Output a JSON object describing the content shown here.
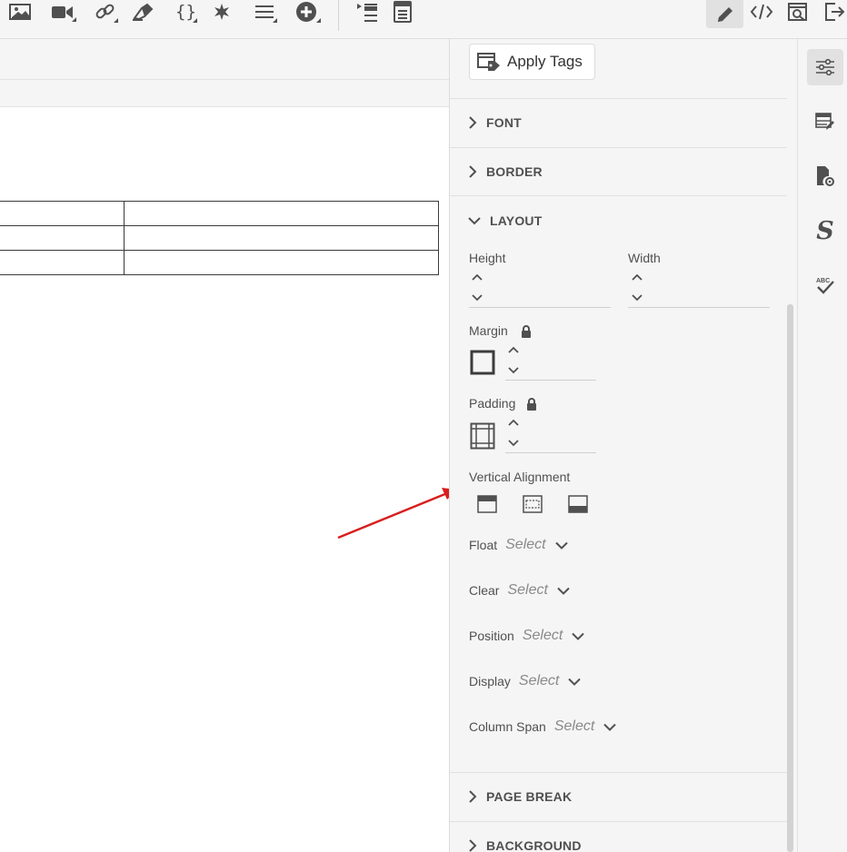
{
  "panel": {
    "apply_tags_label": "Apply Tags",
    "sections": {
      "font": "FONT",
      "border": "BORDER",
      "layout": "LAYOUT",
      "page_break": "PAGE BREAK",
      "background": "BACKGROUND"
    },
    "layout": {
      "height_label": "Height",
      "width_label": "Width",
      "margin_label": "Margin",
      "padding_label": "Padding",
      "vertical_alignment_label": "Vertical Alignment",
      "float": {
        "label": "Float",
        "value": "Select"
      },
      "clear": {
        "label": "Clear",
        "value": "Select"
      },
      "position": {
        "label": "Position",
        "value": "Select"
      },
      "display": {
        "label": "Display",
        "value": "Select"
      },
      "column_span": {
        "label": "Column Span",
        "value": "Select"
      }
    }
  },
  "icons": {
    "toolbar": [
      "image-icon",
      "video-icon",
      "link-icon",
      "eraser-icon",
      "curly-braces-icon",
      "asterisk-icon",
      "align-icon",
      "add-circle-icon",
      "list-indent-icon",
      "document-icon",
      "pencil-icon",
      "code-icon",
      "preview-icon",
      "exit-icon"
    ],
    "rail": [
      "sliders-icon",
      "table-edit-icon",
      "page-settings-icon",
      "style-s-icon",
      "spell-check-icon"
    ]
  },
  "colors": {
    "annotation_arrow": "#d81e1e",
    "panel_background": "#f5f5f5",
    "active_button": "#e1e1e1"
  }
}
